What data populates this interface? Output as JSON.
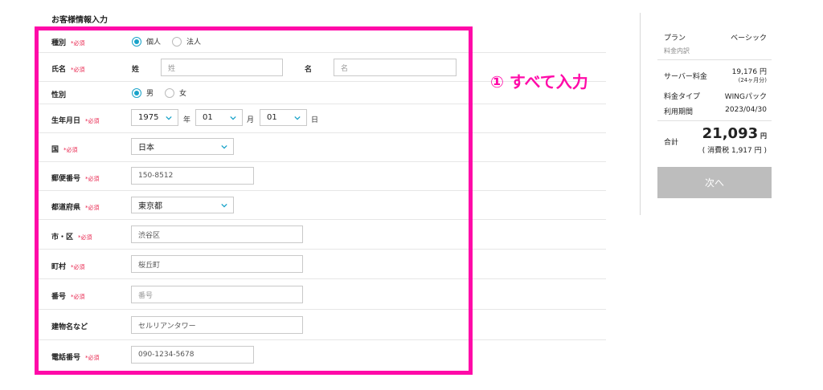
{
  "section_title": "お客様情報入力",
  "required_mark": "*必須",
  "annotation": "① すべて入力",
  "form": {
    "type": {
      "label": "種別",
      "options": [
        "個人",
        "法人"
      ],
      "selected": "個人"
    },
    "name": {
      "label": "氏名",
      "sei_label": "姓",
      "sei_placeholder": "姓",
      "mei_label": "名",
      "mei_placeholder": "名"
    },
    "gender": {
      "label": "性別",
      "options": [
        "男",
        "女"
      ],
      "selected": "男"
    },
    "birthdate": {
      "label": "生年月日",
      "year": "1975",
      "year_unit": "年",
      "month": "01",
      "month_unit": "月",
      "day": "01",
      "day_unit": "日"
    },
    "country": {
      "label": "国",
      "value": "日本"
    },
    "postal": {
      "label": "郵便番号",
      "value": "150-8512"
    },
    "prefecture": {
      "label": "都道府県",
      "value": "東京都"
    },
    "city": {
      "label": "市・区",
      "value": "渋谷区"
    },
    "town": {
      "label": "町村",
      "value": "桜丘町"
    },
    "number": {
      "label": "番号",
      "placeholder": "番号"
    },
    "building": {
      "label": "建物名など",
      "value": "セルリアンタワー"
    },
    "phone": {
      "label": "電話番号",
      "value": "090-1234-5678"
    }
  },
  "summary": {
    "plan_label": "プラン",
    "plan_value": "ベーシック",
    "breakdown_label": "料金内訳",
    "server_fee_label": "サーバー料金",
    "server_fee_value": "19,176 円",
    "server_fee_note": "(24ヶ月分)",
    "fee_type_label": "料金タイプ",
    "fee_type_value": "WINGパック",
    "period_label": "利用期間",
    "period_value": "2023/04/30",
    "total_label": "合計",
    "total_value": "21,093",
    "total_unit": "円",
    "tax_note": "( 消費税 1,917 円 )",
    "next_button": "次へ"
  },
  "colors": {
    "highlight": "#ff0aa8",
    "accent": "#1aa3c9",
    "required": "#e8204a",
    "button_disabled": "#bdbdbd"
  }
}
